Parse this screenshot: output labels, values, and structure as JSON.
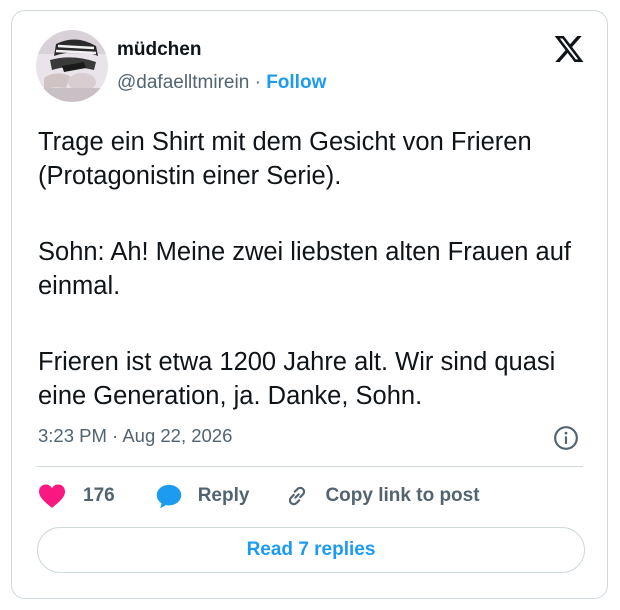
{
  "tweet": {
    "author_name": "müdchen",
    "author_handle": "@dafaelltmirein",
    "separator": "·",
    "follow_label": "Follow",
    "paragraphs": [
      "Trage ein Shirt mit dem Gesicht von Frieren (Protagonistin einer Serie).",
      "Sohn: Ah! Meine zwei liebsten alten Frauen auf einmal.",
      "Frieren ist etwa 1200 Jahre alt. Wir sind quasi eine Generation, ja. Danke, Sohn."
    ],
    "timestamp": "3:23 PM · Aug 22, 2026"
  },
  "actions": {
    "like_count": "176",
    "reply_label": "Reply",
    "copy_link_label": "Copy link to post"
  },
  "read_replies_label": "Read 7 replies",
  "icons": {
    "logo": "x-logo-icon",
    "info": "info-icon",
    "like": "heart-icon",
    "reply": "speech-bubble-icon",
    "copy": "link-icon"
  },
  "colors": {
    "accent": "#1d9bf0",
    "like": "#f91880",
    "text": "#0f1419",
    "muted": "#536471",
    "border": "#cfd9de"
  }
}
